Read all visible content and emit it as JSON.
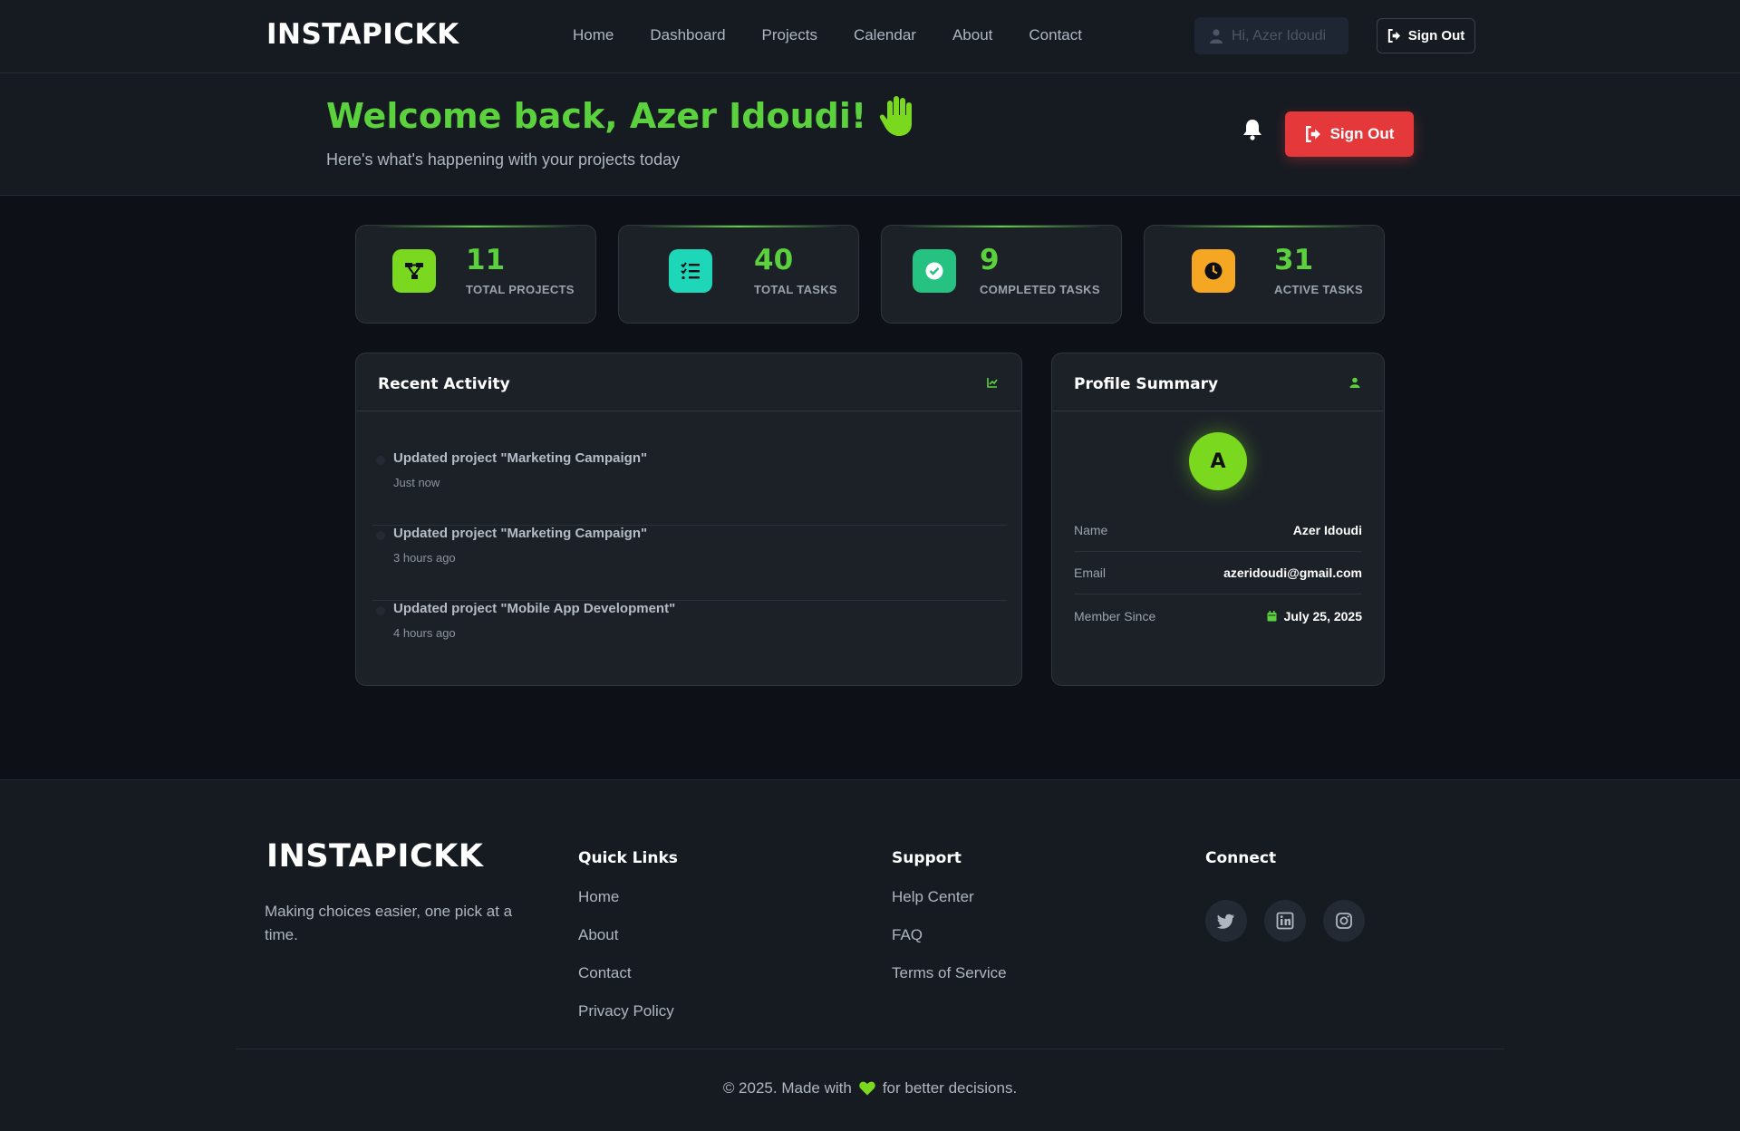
{
  "navbar": {
    "brand": "INSTAPICKK",
    "links": [
      "Home",
      "Dashboard",
      "Projects",
      "Calendar",
      "About",
      "Contact"
    ],
    "greeting": "Hi, Azer Idoudi",
    "signout_label": "Sign Out"
  },
  "hero": {
    "title": "Welcome back, Azer Idoudi!",
    "subtitle": "Here's what's happening with your projects today",
    "signout_label": "Sign Out"
  },
  "stats": [
    {
      "value": "11",
      "label": "TOTAL PROJECTS",
      "icon": "project-diagram-icon",
      "color": "#7ad91f"
    },
    {
      "value": "40",
      "label": "TOTAL TASKS",
      "icon": "tasks-icon",
      "color": "#1ed6b8"
    },
    {
      "value": "9",
      "label": "COMPLETED TASKS",
      "icon": "check-circle-icon",
      "color": "#26c281"
    },
    {
      "value": "31",
      "label": "ACTIVE TASKS",
      "icon": "clock-icon",
      "color": "#f5a623"
    }
  ],
  "activity": {
    "title": "Recent Activity",
    "items": [
      {
        "text": "Updated project \"Marketing Campaign\"",
        "time": "Just now"
      },
      {
        "text": "Updated project \"Marketing Campaign\"",
        "time": "3 hours ago"
      },
      {
        "text": "Updated project \"Mobile App Development\"",
        "time": "4 hours ago"
      }
    ]
  },
  "profile": {
    "title": "Profile Summary",
    "avatar_letter": "A",
    "rows": [
      {
        "key": "Name",
        "value": "Azer Idoudi"
      },
      {
        "key": "Email",
        "value": "azeridoudi@gmail.com"
      },
      {
        "key": "Member Since",
        "value": "July 25, 2025"
      }
    ]
  },
  "footer": {
    "brand": "INSTAPICKK",
    "tagline": "Making choices easier, one pick at a time.",
    "quick_links": {
      "title": "Quick Links",
      "items": [
        "Home",
        "About",
        "Contact",
        "Privacy Policy"
      ]
    },
    "support": {
      "title": "Support",
      "items": [
        "Help Center",
        "FAQ",
        "Terms of Service"
      ]
    },
    "connect": {
      "title": "Connect",
      "icons": [
        "twitter-icon",
        "linkedin-icon",
        "instagram-icon"
      ]
    },
    "copyright_prefix": "© 2025. Made with",
    "copyright_suffix": "for better decisions."
  },
  "colors": {
    "accent": "#5bd13e",
    "danger": "#e5383b",
    "background": "#0d1117",
    "surface": "#1c2128"
  }
}
